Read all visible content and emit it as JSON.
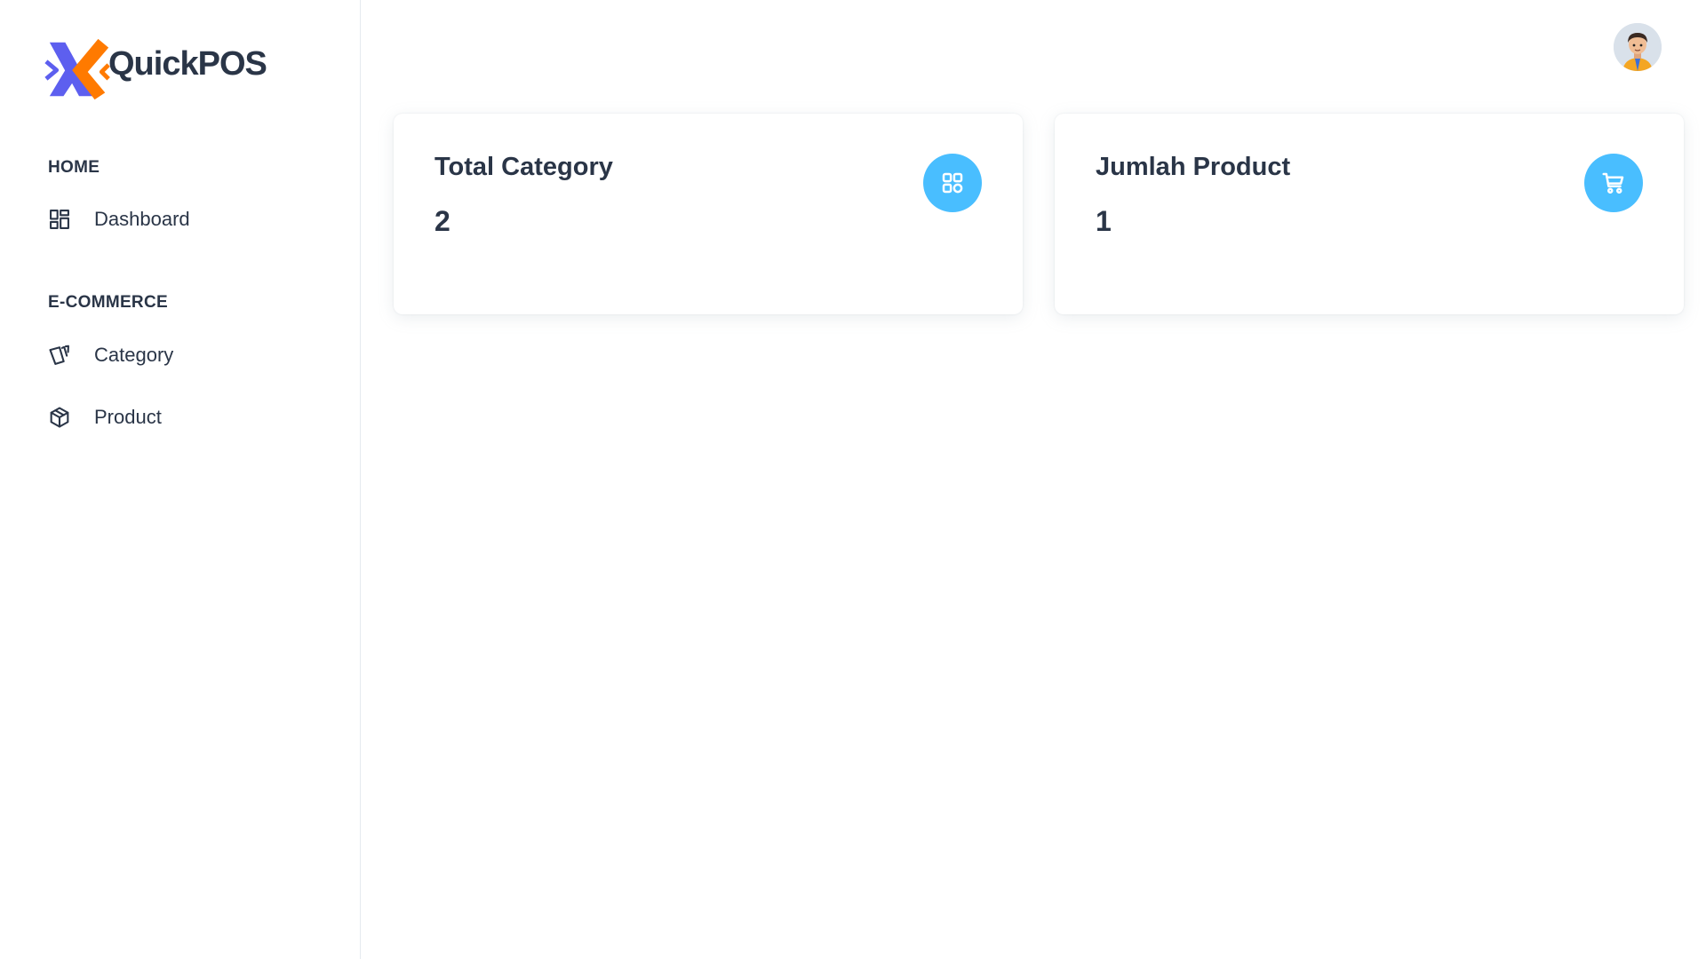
{
  "brand": {
    "name": "QuickPOS",
    "logo_icon": "quickpos-logo-icon",
    "colors": {
      "blue": "#5d5fef",
      "orange": "#ff7a00"
    }
  },
  "sidebar": {
    "sections": [
      {
        "caption": "HOME",
        "items": [
          {
            "label": "Dashboard",
            "icon": "dashboard-icon"
          }
        ]
      },
      {
        "caption": "E-COMMERCE",
        "items": [
          {
            "label": "Category",
            "icon": "cards-icon"
          },
          {
            "label": "Product",
            "icon": "box-icon"
          }
        ]
      }
    ]
  },
  "header": {
    "avatar_icon": "user-avatar"
  },
  "cards": [
    {
      "title": "Total Category",
      "value": "2",
      "icon": "category-grid-icon"
    },
    {
      "title": "Jumlah Product",
      "value": "1",
      "icon": "shopping-cart-icon"
    }
  ],
  "colors": {
    "text": "#2a3547",
    "accent": "#49beff",
    "border": "#e5eaef"
  }
}
